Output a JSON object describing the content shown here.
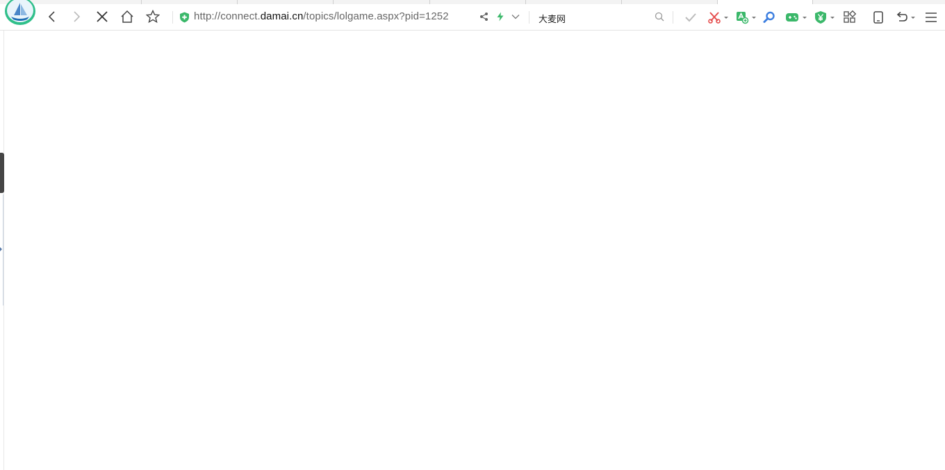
{
  "browser": {
    "address_bar": {
      "url_prefix": "http://connect.",
      "url_domain": "damai.cn",
      "url_suffix": "/topics/lolgame.aspx?pid=1252"
    },
    "search_box": {
      "value": "大麦网"
    },
    "icons": {
      "logo": "sailboat-globe-logo",
      "back": "chevron-left-icon",
      "forward": "chevron-right-icon",
      "stop": "close-icon",
      "home": "home-icon",
      "favorite": "star-icon",
      "security": "shield-plus-icon",
      "share": "share-icon",
      "speed": "lightning-icon",
      "url_dropdown": "chevron-down-icon",
      "search": "magnifier-icon",
      "check": "check-icon",
      "screenshot": "scissors-icon",
      "translate": "translate-icon",
      "find": "search-icon",
      "game": "gamepad-icon",
      "payment": "yen-shield-icon",
      "apps": "apps-grid-icon",
      "mobile": "mobile-icon",
      "undo": "undo-icon",
      "menu": "hamburger-icon"
    },
    "colors": {
      "accent_green": "#3bb86a",
      "red_icon": "#e54d4d",
      "blue_icon": "#3d7fe0"
    }
  }
}
